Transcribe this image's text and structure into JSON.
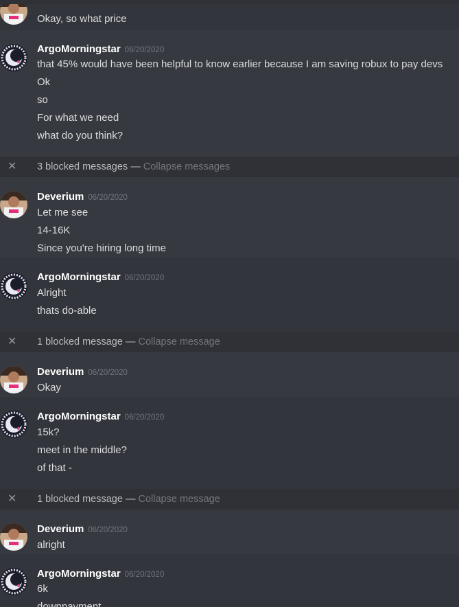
{
  "colors": {
    "background": "#36393f",
    "alt_background": "#32353b",
    "blocked_background": "#2f3136",
    "username": "#ffffff",
    "timestamp": "#72767d",
    "text": "#dcddde"
  },
  "messages": {
    "g0": {
      "username": "Deverium",
      "timestamp": "06/20/2020",
      "lines": [
        "Okay, so what price"
      ]
    },
    "g1": {
      "username": "ArgoMorningstar",
      "timestamp": "06/20/2020",
      "lines": [
        "that 45% would have been helpful to know earlier because I am saving robux to pay devs",
        "Ok",
        "so",
        "For what we need",
        "what do you think?"
      ]
    },
    "b1": {
      "text": "3 blocked messages",
      "dash": " — ",
      "collapse": "Collapse messages",
      "icon": "close-icon"
    },
    "g2": {
      "username": "Deverium",
      "timestamp": "06/20/2020",
      "lines": [
        "Let me see",
        "14-16K",
        "Since you're hiring long time"
      ]
    },
    "g3": {
      "username": "ArgoMorningstar",
      "timestamp": "06/20/2020",
      "lines": [
        "Alright",
        "thats do-able"
      ]
    },
    "b2": {
      "text": "1 blocked message",
      "dash": " — ",
      "collapse": "Collapse message",
      "icon": "close-icon"
    },
    "g4": {
      "username": "Deverium",
      "timestamp": "06/20/2020",
      "lines": [
        "Okay"
      ]
    },
    "g5": {
      "username": "ArgoMorningstar",
      "timestamp": "06/20/2020",
      "lines": [
        "15k?",
        "meet in the middle?",
        "of that -"
      ]
    },
    "b3": {
      "text": "1 blocked message",
      "dash": " — ",
      "collapse": "Collapse message",
      "icon": "close-icon"
    },
    "g6": {
      "username": "Deverium",
      "timestamp": "06/20/2020",
      "lines": [
        "alright"
      ]
    },
    "g7": {
      "username": "ArgoMorningstar",
      "timestamp": "06/20/2020",
      "lines": [
        "6k",
        "downpayment"
      ]
    }
  }
}
